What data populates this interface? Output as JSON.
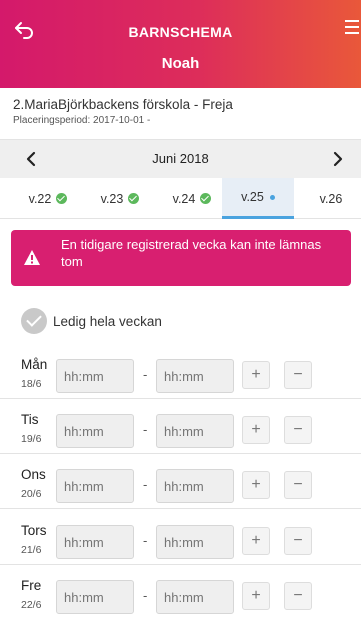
{
  "header": {
    "app_title": "BARNSCHEMA",
    "child_name": "Noah",
    "back_icon": "back-arrow-icon",
    "menu_icon": "hamburger-icon",
    "colors": {
      "gradient_start": "#d4196b",
      "gradient_end": "#e9583a"
    }
  },
  "placement": {
    "school": "2.MariaBjörkbackens förskola - Freja",
    "period": "Placeringsperiod: 2017-10-01 -"
  },
  "month_nav": {
    "label": "Juni 2018",
    "prev_icon": "chevron-left-icon",
    "next_icon": "chevron-right-icon"
  },
  "weeks": [
    {
      "label": "v.22",
      "status": "done"
    },
    {
      "label": "v.23",
      "status": "done"
    },
    {
      "label": "v.24",
      "status": "done"
    },
    {
      "label": "v.25",
      "status": "current"
    },
    {
      "label": "v.26",
      "status": "none"
    }
  ],
  "alert": {
    "message": "En tidigare registrerad vecka kan inte lämnas tom",
    "icon": "warning-icon",
    "color": "#d81f70"
  },
  "free_week": {
    "label": "Ledig hela veckan"
  },
  "days": [
    {
      "name": "Mån",
      "date": "18/6",
      "from_placeholder": "hh:mm",
      "to_placeholder": "hh:mm",
      "dash": "-",
      "plus": "+",
      "minus": "−"
    },
    {
      "name": "Tis",
      "date": "19/6",
      "from_placeholder": "hh:mm",
      "to_placeholder": "hh:mm",
      "dash": "-",
      "plus": "+",
      "minus": "−"
    },
    {
      "name": "Ons",
      "date": "20/6",
      "from_placeholder": "hh:mm",
      "to_placeholder": "hh:mm",
      "dash": "-",
      "plus": "+",
      "minus": "−"
    },
    {
      "name": "Tors",
      "date": "21/6",
      "from_placeholder": "hh:mm",
      "to_placeholder": "hh:mm",
      "dash": "-",
      "plus": "+",
      "minus": "−"
    },
    {
      "name": "Fre",
      "date": "22/6",
      "from_placeholder": "hh:mm",
      "to_placeholder": "hh:mm",
      "dash": "-",
      "plus": "+",
      "minus": "−"
    }
  ]
}
